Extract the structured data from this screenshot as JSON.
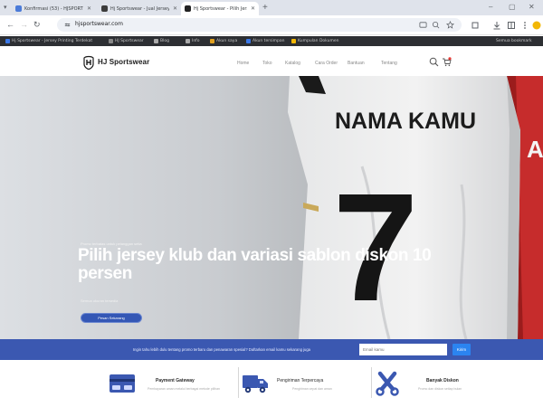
{
  "browser": {
    "tabs": [
      {
        "title": "Konfirmasi (53) - HJSPORTSWEAR"
      },
      {
        "title": "Hj Sportswear - Jual Jersey Printing"
      },
      {
        "title": "Hj Sportswear - Pilih Jersey Klub dan Variasi"
      }
    ],
    "url": "hjsportswear.com",
    "bookmarks": [
      "Hj Sportswear - Jersey Printing Terdekat",
      "HJ Sportswear",
      "Blog",
      "Info",
      "Akun saya",
      "Akun tersimpan",
      "Kumpulan Dokumen",
      "Semua bookmark"
    ]
  },
  "site": {
    "logo_text": "HJ Sportswear",
    "nav": [
      "Home",
      "Toko",
      "Katalog",
      "Cara Order",
      "Bantuan",
      "Tentang"
    ],
    "colors": {
      "primary": "#3b58b1",
      "button": "#2b84f0",
      "logo": "#1b1b1b"
    }
  },
  "hero": {
    "eyebrow": "Promo terbatas untuk pelanggan setia",
    "title": "Pilih jersey klub dan variasi sablon diskon 10 persen",
    "subtitle": "Semua ukuran tersedia",
    "button_label": "Pesan Sekarang",
    "jersey_name": "NAMA KAMU",
    "jersey_number": "7",
    "red_jersey_letter": "A"
  },
  "promo_bar": {
    "text": "Ingin tahu lebih dulu tentang promo terbaru dan penawaran spesial? Daftarkan email kamu sekarang juga",
    "input_placeholder": "Email kamu",
    "button_label": "Kirim"
  },
  "features": [
    {
      "title": "Payment Gateway",
      "subtitle": "Pembayaran aman melalui berbagai metode pilihan",
      "icon": "card-icon"
    },
    {
      "title": "Pengiriman Terpercaya",
      "subtitle": "Pengiriman cepat dan aman",
      "icon": "truck-icon"
    },
    {
      "title": "Banyak Diskon",
      "subtitle": "Promo dan diskon setiap bulan",
      "icon": "scissors-icon"
    }
  ]
}
